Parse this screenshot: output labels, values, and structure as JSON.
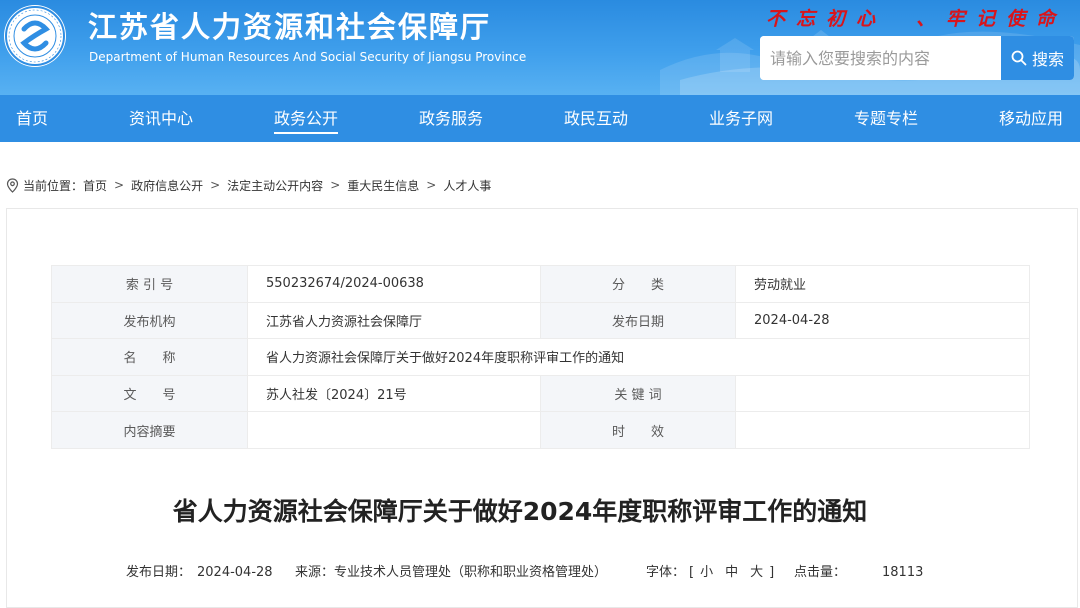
{
  "header": {
    "title": "江苏省人力资源和社会保障厅",
    "subtitle": "Department of Human Resources And Social Security of Jiangsu Province",
    "slogan": "不忘初心　、牢记使命",
    "logo_icon": "department-seal-logo",
    "colors": {
      "primary": "#2f8ee3",
      "slogan": "#d9141b"
    }
  },
  "search": {
    "placeholder": "请输入您要搜索的内容",
    "button_label": "搜索",
    "icon": "search-icon"
  },
  "nav": {
    "items": [
      {
        "label": "首页"
      },
      {
        "label": "资讯中心"
      },
      {
        "label": "政务公开",
        "active": true
      },
      {
        "label": "政务服务"
      },
      {
        "label": "政民互动"
      },
      {
        "label": "业务子网"
      },
      {
        "label": "专题专栏"
      },
      {
        "label": "移动应用"
      }
    ]
  },
  "breadcrumb": {
    "icon": "location-pin-icon",
    "prefix": "当前位置：",
    "items": [
      "首页",
      "政府信息公开",
      "法定主动公开内容",
      "重大民生信息",
      "人才人事"
    ],
    "separator": ">"
  },
  "meta": {
    "index_label": "索 引 号",
    "index_value": "550232674/2024-00638",
    "category_label": "分　　类",
    "category_value": "劳动就业",
    "publisher_label": "发布机构",
    "publisher_value": "江苏省人力资源社会保障厅",
    "date_label": "发布日期",
    "date_value": "2024-04-28",
    "name_label": "名　　称",
    "name_value": "省人力资源社会保障厅关于做好2024年度职称评审工作的通知",
    "docno_label": "文　　号",
    "docno_value": "苏人社发〔2024〕21号",
    "keywords_label": "关 键 词",
    "keywords_value": "",
    "summary_label": "内容摘要",
    "summary_value": "",
    "validity_label": "时　　效",
    "validity_value": ""
  },
  "article": {
    "title": "省人力资源社会保障厅关于做好2024年度职称评审工作的通知",
    "publish_date_label": "发布日期：",
    "publish_date": "2024-04-28",
    "source_label": "来源：",
    "source": "专业技术人员管理处（职称和职业资格管理处）",
    "font_size_label": "字体：",
    "font_size_open": "[",
    "font_small": "小",
    "font_medium": "中",
    "font_large": "大",
    "font_size_close": "]",
    "views_label": "点击量：",
    "views": "18113"
  }
}
